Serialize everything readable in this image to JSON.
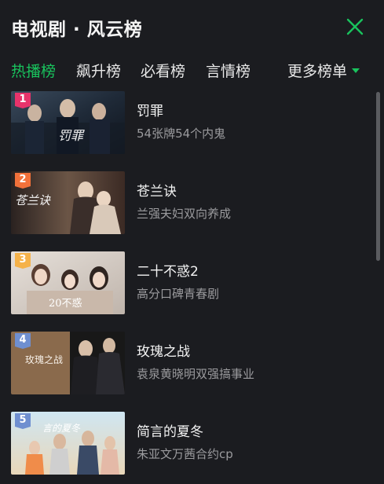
{
  "header": {
    "title": "电视剧 · 风云榜",
    "close_icon": "close-icon"
  },
  "tabs": [
    {
      "label": "热播榜",
      "active": true
    },
    {
      "label": "飙升榜",
      "active": false
    },
    {
      "label": "必看榜",
      "active": false
    },
    {
      "label": "言情榜",
      "active": false
    }
  ],
  "more": {
    "label": "更多榜单",
    "icon": "caret-down-icon"
  },
  "items": [
    {
      "rank": "1",
      "title": "罚罪",
      "desc": "54张牌54个内鬼",
      "badge_color": "#e8336b"
    },
    {
      "rank": "2",
      "title": "苍兰诀",
      "desc": "兰强夫妇双向养成",
      "badge_color": "#f2713a"
    },
    {
      "rank": "3",
      "title": "二十不惑2",
      "desc": "高分口碑青春剧",
      "badge_color": "#f5b24a"
    },
    {
      "rank": "4",
      "title": "玫瑰之战",
      "desc": "袁泉黄晓明双强搞事业",
      "badge_color": "#6f8fd0"
    },
    {
      "rank": "5",
      "title": "简言的夏冬",
      "desc": "朱亚文万茜合约cp",
      "badge_color": "#6f8fd0"
    }
  ],
  "colors": {
    "background": "#1b1c20",
    "accent": "#19c35d",
    "text_primary": "#f3f3f3",
    "text_secondary": "#9b9b9e"
  }
}
